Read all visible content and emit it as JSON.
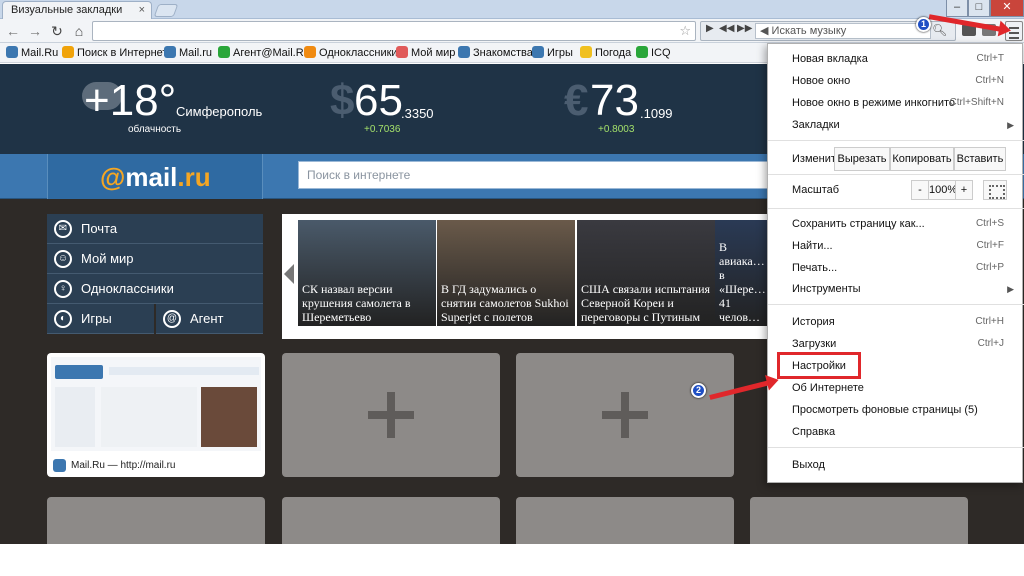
{
  "browser": {
    "tab_title": "Визуальные закладки",
    "tab_close": "×",
    "window_min": "–",
    "window_max": "□",
    "window_close": "✕",
    "address_value": "",
    "music_search_placeholder": "Искать музыку"
  },
  "bookmarks": [
    {
      "label": "Mail.Ru",
      "color": "#3c77b0"
    },
    {
      "label": "Поиск в Интернете",
      "color": "#f0a30a"
    },
    {
      "label": "Mail.ru",
      "color": "#3c77b0"
    },
    {
      "label": "Агент@Mail.Ru",
      "color": "#2aa63a"
    },
    {
      "label": "Одноклассники",
      "color": "#f08a10"
    },
    {
      "label": "Мой мир",
      "color": "#e05a5a"
    },
    {
      "label": "Знакомства",
      "color": "#3c77b0"
    },
    {
      "label": "Игры",
      "color": "#3c77b0"
    },
    {
      "label": "Погода",
      "color": "#f0c020"
    },
    {
      "label": "ICQ",
      "color": "#2aa63a"
    }
  ],
  "weather": {
    "temp": "+18°",
    "city": "Симферополь",
    "condition": "облачность"
  },
  "rates": [
    {
      "symbol": "$",
      "value": "65",
      "fraction": ".3350",
      "change": "+0.7036"
    },
    {
      "symbol": "€",
      "value": "73",
      "fraction": ".1099",
      "change": "+0.8003"
    }
  ],
  "logo": {
    "at": "@",
    "text": "mail",
    "dot": ".ru"
  },
  "web_search_placeholder": "Поиск в интернете",
  "services": [
    {
      "label": "Почта",
      "icon": "✉"
    },
    {
      "label": "Мой мир",
      "icon": "☺"
    },
    {
      "label": "Одноклассники",
      "icon": "♀"
    },
    {
      "label": "Игры",
      "icon": "◐"
    },
    {
      "label": "Агент",
      "icon": "@"
    }
  ],
  "news": [
    {
      "caption": "СК назвал версии крушения самолета в Шереметьево",
      "color": "#4a5a6a"
    },
    {
      "caption": "В ГД задумались о снятии самолетов Sukhoi Superjet с полетов",
      "color": "#6a5a4a"
    },
    {
      "caption": "США связали испытания Северной Кореи и переговоры с Путиным",
      "color": "#3a3a40"
    },
    {
      "caption": "В авиака… в «Шере… 41 челов…",
      "color": "#2a3a55"
    }
  ],
  "thumbnail": {
    "label": "Mail.Ru — http://mail.ru"
  },
  "menu": {
    "new_tab": "Новая вкладка",
    "new_tab_sc": "Ctrl+T",
    "new_window": "Новое окно",
    "new_window_sc": "Ctrl+N",
    "incognito": "Новое окно в режиме инкогнито",
    "incognito_sc": "Ctrl+Shift+N",
    "bookmarks": "Закладки",
    "edit": "Изменить",
    "cut": "Вырезать",
    "copy": "Копировать",
    "paste": "Вставить",
    "zoom": "Масштаб",
    "zoom_minus": "-",
    "zoom_value": "100%",
    "zoom_plus": "+",
    "save_page": "Сохранить страницу как...",
    "save_page_sc": "Ctrl+S",
    "find": "Найти...",
    "find_sc": "Ctrl+F",
    "print": "Печать...",
    "print_sc": "Ctrl+P",
    "tools": "Инструменты",
    "history": "История",
    "history_sc": "Ctrl+H",
    "downloads": "Загрузки",
    "downloads_sc": "Ctrl+J",
    "settings": "Настройки",
    "about": "Об Интернете",
    "background_pages": "Просмотреть фоновые страницы (5)",
    "help": "Справка",
    "exit": "Выход",
    "arrow": "▶"
  },
  "annotations": {
    "step1": "1",
    "step2": "2",
    "color": "#e0272b"
  }
}
